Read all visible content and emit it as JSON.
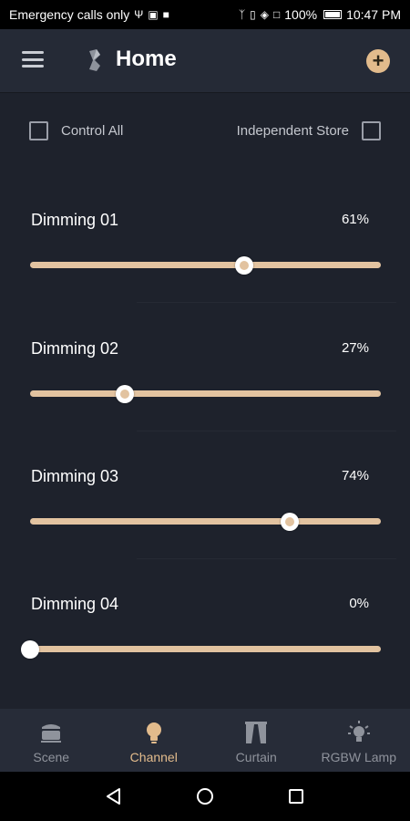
{
  "status_bar": {
    "carrier_text": "Emergency calls only",
    "battery": "100%",
    "time": "10:47 PM"
  },
  "app_bar": {
    "title": "Home",
    "menu_icon": "hamburger-menu-icon",
    "logo_icon": "bluetooth-icon",
    "add_icon": "plus-circle-icon"
  },
  "options": {
    "control_all": {
      "label": "Control All",
      "checked": false
    },
    "independent_store": {
      "label": "Independent Store",
      "checked": false
    }
  },
  "channels": [
    {
      "name": "Dimming 01",
      "value_text": "61%",
      "value": 61
    },
    {
      "name": "Dimming 02",
      "value_text": "27%",
      "value": 27
    },
    {
      "name": "Dimming 03",
      "value_text": "74%",
      "value": 74
    },
    {
      "name": "Dimming 04",
      "value_text": "0%",
      "value": 0
    }
  ],
  "bottom_nav": [
    {
      "label": "Scene",
      "icon": "scene-icon",
      "active": false
    },
    {
      "label": "Channel",
      "icon": "bulb-icon",
      "active": true
    },
    {
      "label": "Curtain",
      "icon": "curtain-icon",
      "active": false
    },
    {
      "label": "RGBW Lamp",
      "icon": "lamp-icon",
      "active": false
    }
  ],
  "colors": {
    "accent": "#e2bb8c",
    "track": "#e2c3a0",
    "background": "#1e222c",
    "bar": "#252a36"
  }
}
